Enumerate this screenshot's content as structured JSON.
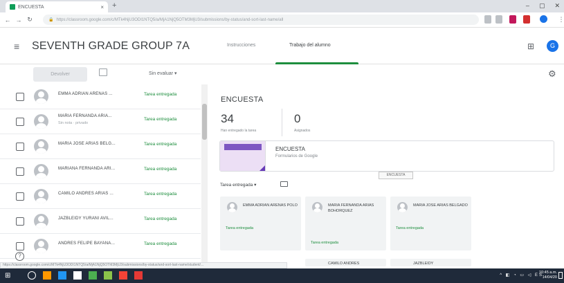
{
  "browser": {
    "tab_title": "ENCUESTA",
    "new_tab": "+",
    "address": "https://classroom.google.com/c/MTk4NjU3ODI1NTQ5/a/MjA1NjQ5OTM3MjU3/submissions/by-status/and-sort-last-name/all",
    "window_buttons": [
      "–",
      "▢",
      "✕"
    ]
  },
  "appbar": {
    "menu_glyph": "≡",
    "class_title": "SEVENTH GRADE GROUP 7A",
    "tabs": [
      {
        "label": "Instrucciones"
      },
      {
        "label": "Trabajo del alumno"
      }
    ],
    "apps_glyph": "⊞",
    "avatar_letter": "G"
  },
  "toolbar": {
    "return_label": "Devolver",
    "points_select": "Sin evaluar  ▾",
    "settings_glyph": "⚙"
  },
  "students": [
    {
      "name": "EMMA ADRIAN ARENAS ...",
      "sub": "",
      "status": "Tarea entregada"
    },
    {
      "name": "MARIA FERNANDA ARIA...",
      "sub": "Sin nota · privado",
      "status": "Tarea entregada"
    },
    {
      "name": "MARIA JOSE ARIAS BELG...",
      "sub": "",
      "status": "Tarea entregada"
    },
    {
      "name": "MARIANA FERNANDA ARI...",
      "sub": "",
      "status": "Tarea entregada"
    },
    {
      "name": "CAMILO ANDRES ARIAS ...",
      "sub": "",
      "status": "Tarea entregada"
    },
    {
      "name": "JAZBLEIDY YURANI AVIL...",
      "sub": "",
      "status": "Tarea entregada"
    },
    {
      "name": "ANDRES FELIPE BAYANA...",
      "sub": "",
      "status": "Tarea entregada"
    }
  ],
  "detail": {
    "title": "ENCUESTA",
    "turned_in_count": "34",
    "turned_in_label": "Han entregado la tarea",
    "assigned_count": "0",
    "assigned_label": "Asignados",
    "attachment_title": "ENCUESTA",
    "attachment_sub": "Formularios de Google",
    "tooltip": "ENCUESTA",
    "section_label": "Tarea entregada  ▾",
    "cards": [
      {
        "name": "EMMA ADRIAN ARENAS POLO",
        "status": "Tarea entregada"
      },
      {
        "name": "MARIA FERNANDA ARIAS BOHORQUEZ",
        "status": "Tarea entregada"
      },
      {
        "name": "MARIA JOSE ARIAS BELGADO",
        "status": "Tarea entregada"
      },
      {
        "name": "CAMILO ANDRES",
        "status": ""
      },
      {
        "name": "JAZBLEIDY",
        "status": ""
      }
    ]
  },
  "statusbar": "https://classroom.google.com/c/MTk4NjU3ODI1NTQ5/a/MjA1NjQ5OTM3MjU3/submissions/by-status/and-sort-last-name/student/...",
  "help_glyph": "?",
  "taskbar": {
    "start_glyph": "⊞",
    "tray": "^ ◧ ◔ ▭ ◁ ES",
    "time": "10:45 a.m.",
    "date": "14/04/20"
  },
  "colors": {
    "accent_green": "#1e8e3e",
    "avatar_blue": "#1a73e8",
    "form_purple": "#7e57c2"
  }
}
